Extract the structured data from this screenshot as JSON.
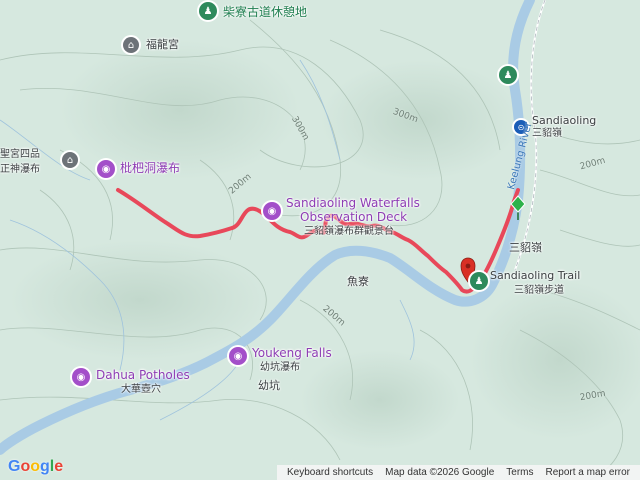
{
  "map": {
    "pois": {
      "chaoliao_rest_area": "柴寮古道休憩地",
      "fulong_temple": "福龍宮",
      "temple_left_1": "聖宮四品",
      "temple_left_2": "正神瀑布",
      "pipa_falls": "枇杷洞瀑布",
      "sandiaoling_waterfalls_en": "Sandiaoling Waterfalls",
      "observation_deck_en": "Observation Deck",
      "observation_deck_zh": "三貂嶺瀑布群觀景台",
      "sandiaoling_station_en": "Sandiaoling",
      "sandiaoling_station_zh": "三貂嶺",
      "keelung_river": "Keelung River",
      "sandiaoling_area": "三貂嶺",
      "sandiaoling_trail_en": "Sandiaoling Trail",
      "sandiaoling_trail_zh": "三貂嶺步道",
      "yuliao": "魚寮",
      "youkeng_falls_en": "Youkeng Falls",
      "youkeng_falls_zh": "幼坑瀑布",
      "youkeng": "幼坑",
      "dahua_potholes_en": "Dahua Potholes",
      "dahua_potholes_zh": "大華壺穴"
    },
    "contours": {
      "c1": "300m",
      "c2": "300m",
      "c3": "200m",
      "c4": "200m",
      "c5": "200m",
      "c6": "200m"
    },
    "icons": {
      "camera": "camera-icon",
      "temple": "temple-icon",
      "rest_area": "rest-area-icon",
      "train": "train-station-icon",
      "start_marker": "start-flag-icon",
      "end_marker": "end-pin-icon"
    },
    "colors": {
      "route": "#e8485a",
      "river": "#a9cbe5",
      "poi_attraction": "#a34fc9",
      "poi_park": "#2e8a5c",
      "start_marker": "#2eb24a",
      "end_marker": "#d93025"
    }
  },
  "footer": {
    "logo": "Google",
    "keyboard_shortcuts": "Keyboard shortcuts",
    "map_data": "Map data ©2026 Google",
    "terms": "Terms",
    "report": "Report a map error"
  }
}
